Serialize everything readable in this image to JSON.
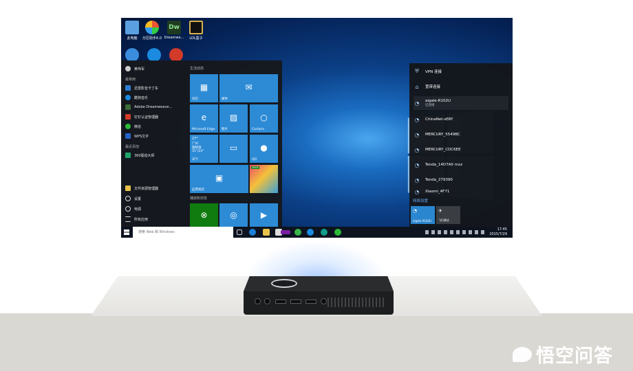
{
  "desktop": {
    "icons": [
      {
        "label": "此电脑",
        "icon": "this-pc-icon"
      },
      {
        "label": "分区助手6.0",
        "icon": "partition-assistant-icon"
      },
      {
        "label": "Dreamwe...",
        "icon": "dreamweaver-icon",
        "glyph": "Dw"
      },
      {
        "label": "LOL盒子",
        "icon": "lol-box-icon"
      }
    ]
  },
  "start_menu": {
    "user": "黄伟军",
    "most_used_header": "最常用",
    "apps": [
      {
        "label": "迅雷影音卡丁车",
        "color": "#2e7dd1"
      },
      {
        "label": "酷狗音乐",
        "color": "#1a8be0"
      },
      {
        "label": "Adobe Dreamweave...",
        "color": "#3a6b3a"
      },
      {
        "label": "钉钉认证管理器",
        "color": "#d23a2a"
      },
      {
        "label": "微信",
        "color": "#2dbb3b"
      },
      {
        "label": "WPS文字",
        "color": "#2563c7"
      }
    ],
    "recent_header": "最近添加",
    "recent_apps": [
      {
        "label": "360驱动大师",
        "color": "#1fa36b"
      }
    ],
    "bottom_items": [
      {
        "label": "文件资源管理器",
        "icon": "folder-icon"
      },
      {
        "label": "设置",
        "icon": "gear-icon"
      },
      {
        "label": "电源",
        "icon": "power-icon"
      },
      {
        "label": "所有应用",
        "icon": "list-icon"
      }
    ],
    "tiles_header_1": "生活动态",
    "tiles_header_2": "播放和浏览",
    "tiles": {
      "calendar": "日历",
      "mail": "邮件",
      "edge": "Microsoft Edge",
      "photos": "照片",
      "cortana": "Cortana",
      "weather_temp": "27°",
      "weather_city": "广州",
      "weather_cond": "雷阵雨",
      "weather_range": "31°/24°",
      "weather_label": "天气",
      "qq": "QQ",
      "xbox_badge": "XBOX",
      "store": "应用商店"
    }
  },
  "network": {
    "vpn": "VPN 连接",
    "hotspot": "宽带连接",
    "networks": [
      {
        "name": "aigale-R102U",
        "status": "已连接"
      },
      {
        "name": "ChinaNet-sERY"
      },
      {
        "name": "MERCURY_5549BC"
      },
      {
        "name": "MERCURY_CDC6EE"
      },
      {
        "name": "Tenda_14D7A0 mxz"
      },
      {
        "name": "Tenda_279390"
      },
      {
        "name": "Xiaomi_4F71"
      }
    ],
    "settings": "网络设置",
    "tile_wifi": "aigale-R102U",
    "tile_airplane": "飞行模式"
  },
  "taskbar": {
    "search": "搜索 Web 和 Windows",
    "time": "17:45",
    "date": "2015/7/29"
  },
  "watermark": "悟空问答"
}
